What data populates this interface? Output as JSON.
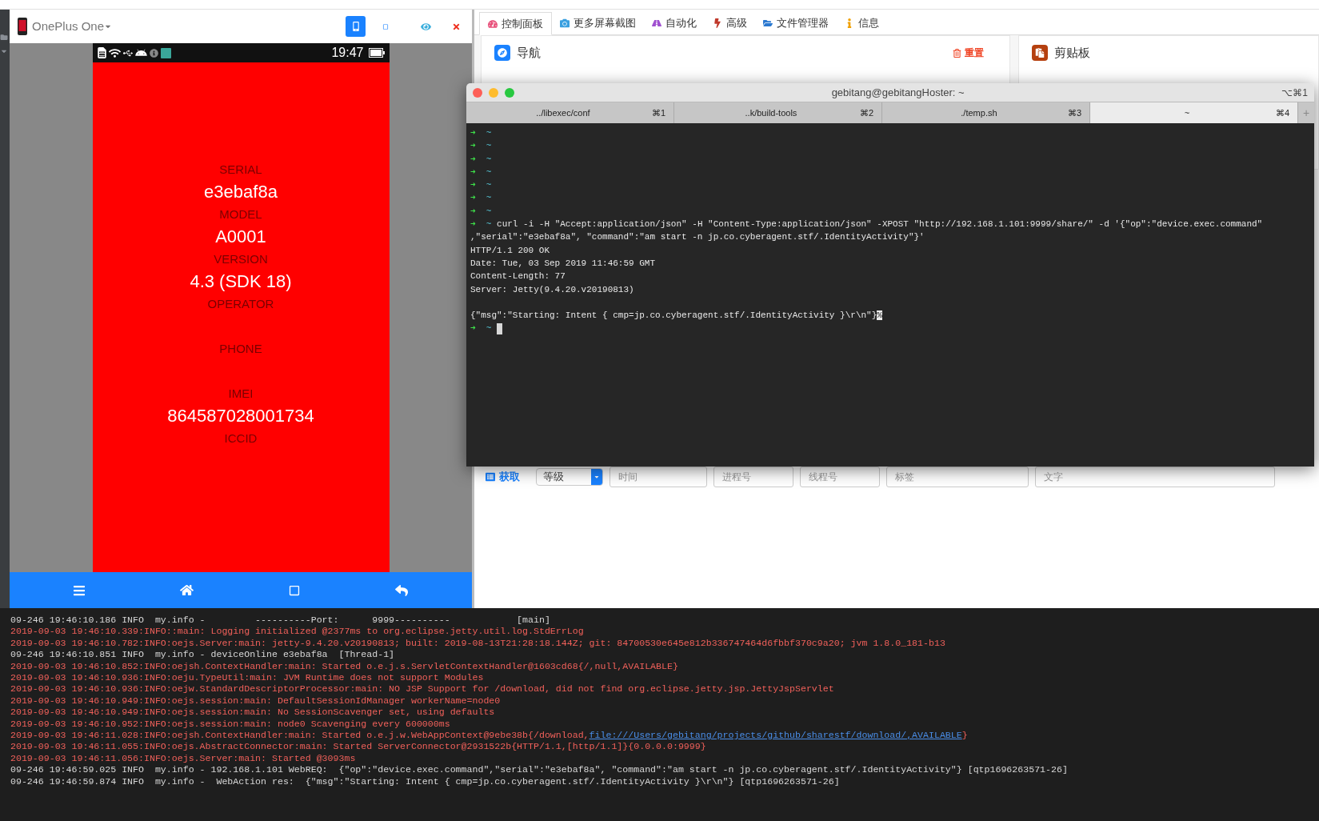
{
  "phone_window": {
    "device": "OnePlus One",
    "view_modes": [
      {
        "kind": "portrait",
        "selected": true
      },
      {
        "kind": "landscape",
        "selected": false
      }
    ],
    "status_bar": {
      "time": "19:47"
    },
    "fields": [
      {
        "label": "SERIAL",
        "value": "e3ebaf8a"
      },
      {
        "label": "MODEL",
        "value": "A0001"
      },
      {
        "label": "VERSION",
        "value": "4.3 (SDK 18)"
      },
      {
        "label": "OPERATOR"
      },
      {
        "label": "PHONE"
      },
      {
        "label": "IMEI",
        "value": "864587028001734"
      },
      {
        "label": "ICCID"
      }
    ]
  },
  "web_panel": {
    "tabs": [
      {
        "label": "控制面板",
        "selected": true
      },
      {
        "label": "更多屏幕截图",
        "selected": false
      },
      {
        "label": "自动化",
        "selected": false
      },
      {
        "label": "高级",
        "selected": false
      },
      {
        "label": "文件管理器",
        "selected": false
      },
      {
        "label": "信息",
        "selected": false
      }
    ],
    "navigation_card": {
      "title": "导航",
      "reset": "重置"
    },
    "clipboard_card": {
      "title": "剪贴板"
    },
    "log_filter": {
      "fetch": "获取",
      "level": "等级",
      "fields": [
        {
          "placeholder": "时间"
        },
        {
          "placeholder": "进程号"
        },
        {
          "placeholder": "线程号"
        },
        {
          "placeholder": "标签"
        },
        {
          "placeholder": "文字"
        }
      ]
    }
  },
  "terminal": {
    "title": "gebitang@gebitangHoster: ~",
    "shortcut": "⌥⌘1",
    "tabs": [
      {
        "label": "../libexec/conf",
        "shortcut": "⌘1",
        "selected": false
      },
      {
        "label": "..k/build-tools",
        "shortcut": "⌘2",
        "selected": false
      },
      {
        "label": "./temp.sh",
        "shortcut": "⌘3",
        "selected": false
      },
      {
        "label": "~",
        "shortcut": "⌘4",
        "selected": true
      }
    ],
    "new_tab": "+",
    "lines": [
      {
        "kind": "prompt",
        "arrow": "➜",
        "cwd": "~"
      },
      {
        "kind": "prompt",
        "arrow": "➜",
        "cwd": "~"
      },
      {
        "kind": "prompt",
        "arrow": "➜",
        "cwd": "~"
      },
      {
        "kind": "prompt",
        "arrow": "➜",
        "cwd": "~"
      },
      {
        "kind": "prompt",
        "arrow": "➜",
        "cwd": "~"
      },
      {
        "kind": "prompt",
        "arrow": "➜",
        "cwd": "~"
      },
      {
        "kind": "prompt",
        "arrow": "➜",
        "cwd": "~"
      },
      {
        "kind": "prompt",
        "arrow": "➜",
        "cwd": "~",
        "command": "curl -i -H \"Accept:application/json\" -H \"Content-Type:application/json\" -XPOST \"http://192.168.1.101:9999/share/\" -d '{\"op\":\"device.exec.command\""
      },
      {
        "kind": "output",
        "text": ",\"serial\":\"e3ebaf8a\", \"command\":\"am start -n jp.co.cyberagent.stf/.IdentityActivity\"}'"
      },
      {
        "kind": "output",
        "text": "HTTP/1.1 200 OK"
      },
      {
        "kind": "output",
        "text": "Date: Tue, 03 Sep 2019 11:46:59 GMT"
      },
      {
        "kind": "output",
        "text": "Content-Length: 77"
      },
      {
        "kind": "output",
        "text": "Server: Jetty(9.4.20.v20190813)"
      },
      {
        "kind": "blank"
      },
      {
        "kind": "output",
        "text": "{\"msg\":\"Starting: Intent { cmp=jp.co.cyberagent.stf/.IdentityActivity }\\r\\n\"}",
        "mark": "%"
      },
      {
        "kind": "prompt",
        "arrow": "➜",
        "cwd": "~",
        "cursor": true
      }
    ]
  },
  "log_console": {
    "lines": [
      {
        "kind": "stdout",
        "text": "09-246 19:46:10.186 INFO  my.info -         ----------Port:      9999----------            [main]"
      },
      {
        "kind": "stderr",
        "text": "2019-09-03 19:46:10.339:INFO::main: Logging initialized @2377ms to org.eclipse.jetty.util.log.StdErrLog"
      },
      {
        "kind": "stderr",
        "text": "2019-09-03 19:46:10.782:INFO:oejs.Server:main: jetty-9.4.20.v20190813; built: 2019-08-13T21:28:18.144Z; git: 84700530e645e812b336747464d6fbbf370c9a20; jvm 1.8.0_181-b13"
      },
      {
        "kind": "stdout",
        "text": "09-246 19:46:10.851 INFO  my.info - deviceOnline e3ebaf8a  [Thread-1]"
      },
      {
        "kind": "stderr",
        "text": "2019-09-03 19:46:10.852:INFO:oejsh.ContextHandler:main: Started o.e.j.s.ServletContextHandler@1603cd68{/,null,AVAILABLE}"
      },
      {
        "kind": "stderr",
        "text": "2019-09-03 19:46:10.936:INFO:oeju.TypeUtil:main: JVM Runtime does not support Modules"
      },
      {
        "kind": "stderr",
        "text": "2019-09-03 19:46:10.936:INFO:oejw.StandardDescriptorProcessor:main: NO JSP Support for /download, did not find org.eclipse.jetty.jsp.JettyJspServlet"
      },
      {
        "kind": "stderr",
        "text": "2019-09-03 19:46:10.949:INFO:oejs.session:main: DefaultSessionIdManager workerName=node0"
      },
      {
        "kind": "stderr",
        "text": "2019-09-03 19:46:10.949:INFO:oejs.session:main: No SessionScavenger set, using defaults"
      },
      {
        "kind": "stderr",
        "text": "2019-09-03 19:46:10.952:INFO:oejs.session:main: node0 Scavenging every 600000ms"
      },
      {
        "kind": "stderr",
        "text": "2019-09-03 19:46:11.028:INFO:oejsh.ContextHandler:main: Started o.e.j.w.WebAppContext@9ebe38b{/download,",
        "link": "file:///Users/gebitang/projects/github/sharestf/download/,AVAILABLE",
        "rest": "}"
      },
      {
        "kind": "stderr",
        "text": "2019-09-03 19:46:11.055:INFO:oejs.AbstractConnector:main: Started ServerConnector@2931522b{HTTP/1.1,[http/1.1]}{0.0.0.0:9999}"
      },
      {
        "kind": "stderr",
        "text": "2019-09-03 19:46:11.056:INFO:oejs.Server:main: Started @3093ms"
      },
      {
        "kind": "stdout",
        "text": "09-246 19:46:59.025 INFO  my.info - 192.168.1.101 WebREQ:  {\"op\":\"device.exec.command\",\"serial\":\"e3ebaf8a\", \"command\":\"am start -n jp.co.cyberagent.stf/.IdentityActivity\"} [qtp1696263571-26]"
      },
      {
        "kind": "stdout",
        "text": "09-246 19:46:59.874 INFO  my.info -  WebAction res:  {\"msg\":\"Starting: Intent { cmp=jp.co.cyberagent.stf/.IdentityActivity }\\r\\n\"} [qtp1696263571-26]"
      }
    ]
  }
}
